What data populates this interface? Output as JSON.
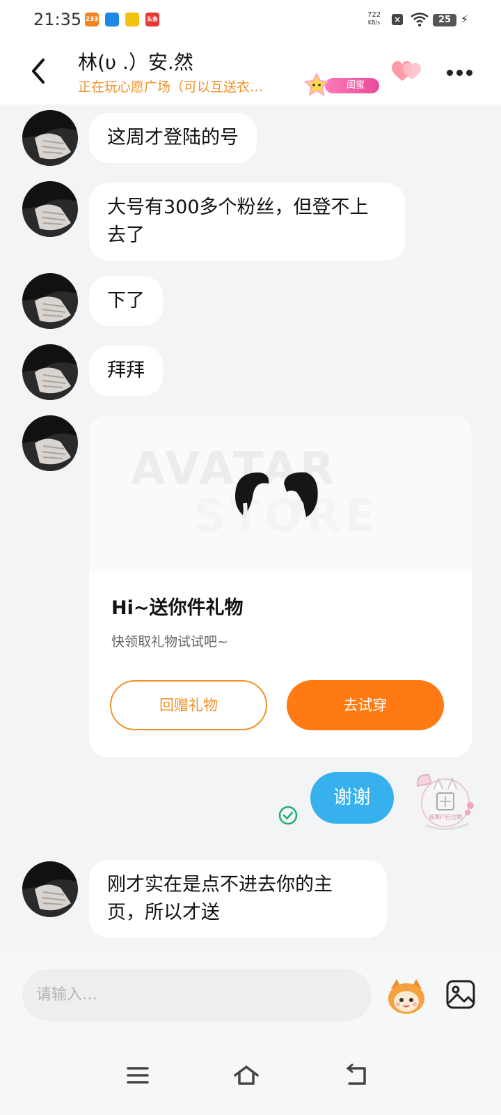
{
  "status_bar": {
    "time": "21:35",
    "app_icons": [
      {
        "name": "app-233-icon",
        "text": "233",
        "color": "#f5831f"
      },
      {
        "name": "app-blue-icon",
        "text": "",
        "color": "#1e88e5"
      },
      {
        "name": "app-clapper-icon",
        "text": "",
        "color": "#f4c20d"
      },
      {
        "name": "app-news-icon",
        "text": "头条",
        "color": "#e53935"
      }
    ],
    "net_speed_value": "722",
    "net_speed_unit": "KB/s",
    "battery": "25"
  },
  "header": {
    "title": "林(υ .）安.然",
    "subtitle": "正在玩心愿广场（可以互送衣…",
    "relationship_badge": "闺蜜",
    "accent_color": "#f0922b"
  },
  "messages": [
    {
      "sender": "other",
      "text": "这周才登陆的号"
    },
    {
      "sender": "other",
      "text": "大号有300多个粉丝，但登不上去了"
    },
    {
      "sender": "other",
      "text": "下了"
    },
    {
      "sender": "other",
      "text": "拜拜"
    },
    {
      "sender": "other",
      "type": "gift_card"
    },
    {
      "sender": "me",
      "text": "谢谢",
      "status": "read-check"
    },
    {
      "sender": "other",
      "text": "刚才实在是点不进去你的主页，所以才送"
    }
  ],
  "gift_card": {
    "watermark_top": "AVATAR",
    "watermark_bottom": "STORE",
    "title": "Hi~送你件礼物",
    "subtitle": "快领取礼物试试吧~",
    "return_gift_label": "回赠礼物",
    "try_on_label": "去试穿",
    "button_color": "#ff7a12"
  },
  "my_avatar_text": "该用户已注销",
  "input": {
    "placeholder": "请输入…"
  },
  "colors": {
    "sent_bubble": "#36b1ee",
    "chat_background": "#f2f4f5",
    "check": "#1fae6e"
  }
}
